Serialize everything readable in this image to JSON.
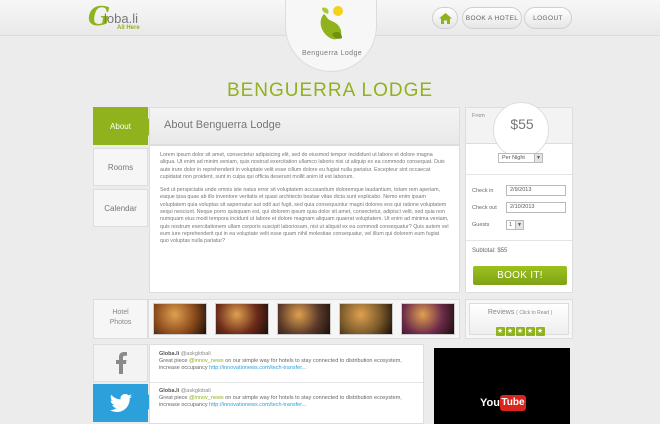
{
  "header": {
    "logo_letter": "G",
    "logo_text": "loba.li",
    "logo_sub": "All Here",
    "nav": {
      "home_icon": "home-icon",
      "book_label": "BOOK A HOTEL",
      "logout_label": "LOGOUT"
    }
  },
  "badge": {
    "name": "Benguerra Lodge"
  },
  "page_title": "BENGUERRA LODGE",
  "tabs": [
    "About",
    "Rooms",
    "Calendar"
  ],
  "about": {
    "title": "About Benguerra Lodge",
    "p1": "Lorem ipsum dolor sit amet, consectetur adipisicing elit, sed do eiusmod tempor incididunt ut labore et dolore magna aliqua. Ut enim ad minim veniam, quis nostrud exercitation ullamco laboris nisi ut aliquip ex ea commodo consequat. Duis aute irure dolor in reprehenderit in voluptate velit esse cillum dolore eu fugiat nulla pariatur. Excepteur sint occaecat cupidatat non proident, sunt in culpa qui officia deserunt mollit anim id est laborum.",
    "p2": "Sed ut perspiciatis unde omnis iste natus error sit voluptatem accusantium doloremque laudantium, totam rem aperiam, eaque ipsa quae ab illo inventore veritatis et quasi architecto beatae vitae dicta sunt explicabo. Nemo enim ipsam voluptatem quia voluptas sit aspernatur aut odit aut fugit, sed quia consequuntur magni dolores eos qui ratione voluptatem sequi nesciunt. Neque porro quisquam est, qui dolorem ipsum quia dolor sit amet, consectetur, adipisci velit, sed quia non numquam eius modi tempora incidunt ut labore et dolore magnam aliquam quaerat voluptatem. Ut enim ad minima veniam, quis nostrum exercitationem ullam corporis suscipit laboriosam, nisi ut aliquid ex ea commodi consequatur? Quis autem vel eum iure reprehenderit qui in ea voluptate velit esse quam nihil molestiae consequatur, vel illum qui dolorem eum fugiat quo voluptas nulla pariatur?"
  },
  "booking": {
    "from_label": "From",
    "price": "$55",
    "rate_option": "Per Night",
    "checkin_label": "Check in",
    "checkin_value": "2/9/2013",
    "checkout_label": "Check out",
    "checkout_value": "2/10/2013",
    "guests_label": "Guests",
    "guests_value": "1",
    "subtotal": "Subtotal: $55",
    "book_label": "BOOK IT!"
  },
  "photos": {
    "label_line1": "Hotel",
    "label_line2": "Photos",
    "colors": [
      "#8a4a1c",
      "#6b2b1a",
      "#5a3a2a",
      "#7a5a2a",
      "#6a2a4a",
      "#3a2a1a"
    ]
  },
  "reviews": {
    "title": "Reviews",
    "hint": "( Click to Read )",
    "stars": 5
  },
  "social": {
    "fb_icon": "facebook-icon",
    "tw_icon": "twitter-icon"
  },
  "tweets": [
    {
      "name": "Globa.li",
      "handle": "@askglobali",
      "pre": "Great piece ",
      "mention": "@innov_news",
      "post": " on our simple way for hotels to stay connected to distribution ecosystem, increase occupancy ",
      "link": "http://innovationews.com/tech-transfer..."
    },
    {
      "name": "Globa.li",
      "handle": "@askglobali",
      "pre": "Great piece ",
      "mention": "@innov_news",
      "post": " on our simple way for hotels to stay connected to distribution ecosystem, increase occupancy ",
      "link": "http://innovationews.com/tech-transfer..."
    }
  ],
  "video": {
    "brand_you": "You",
    "brand_tube": "Tube"
  },
  "colors": {
    "accent": "#8fb21d",
    "twitter": "#2ca0da",
    "youtube": "#d8261d"
  }
}
